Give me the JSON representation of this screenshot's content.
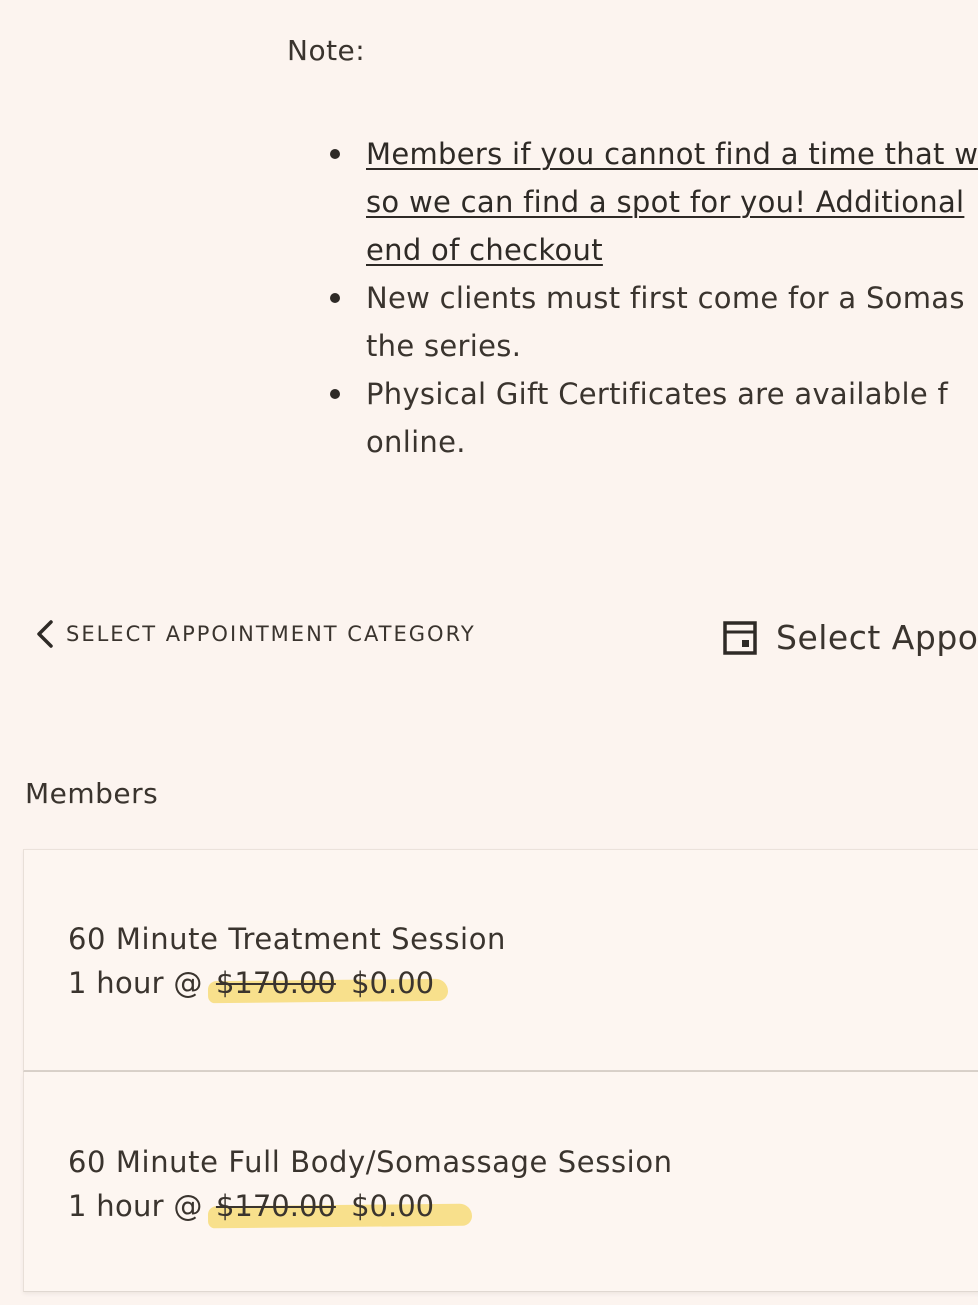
{
  "note": {
    "label": "Note:",
    "items": [
      {
        "lines": [
          "Members if you cannot find a time that w",
          "so we can find a spot for you! Additional",
          "end of checkout"
        ],
        "is_link": true
      },
      {
        "lines": [
          "New clients must first come for a Somas",
          "the series."
        ],
        "is_link": false
      },
      {
        "lines": [
          "Physical Gift Certificates are available f",
          "online."
        ],
        "is_link": false
      }
    ]
  },
  "nav": {
    "back_label": "SELECT APPOINTMENT CATEGORY",
    "back_icon": "chevron-left-icon",
    "select_label": "Select Appo",
    "select_icon": "calendar-icon"
  },
  "section": {
    "title": "Members"
  },
  "appointments": [
    {
      "title": "60 Minute Treatment Session",
      "duration": "1 hour @",
      "old_price": "$170.00",
      "new_price": "$0.00"
    },
    {
      "title": "60 Minute Full Body/Somassage Session",
      "duration": "1 hour @",
      "old_price": "$170.00",
      "new_price": "$0.00"
    }
  ],
  "colors": {
    "background": "#fcf4ef",
    "text": "#3a342e",
    "highlight": "#f6d86a"
  }
}
